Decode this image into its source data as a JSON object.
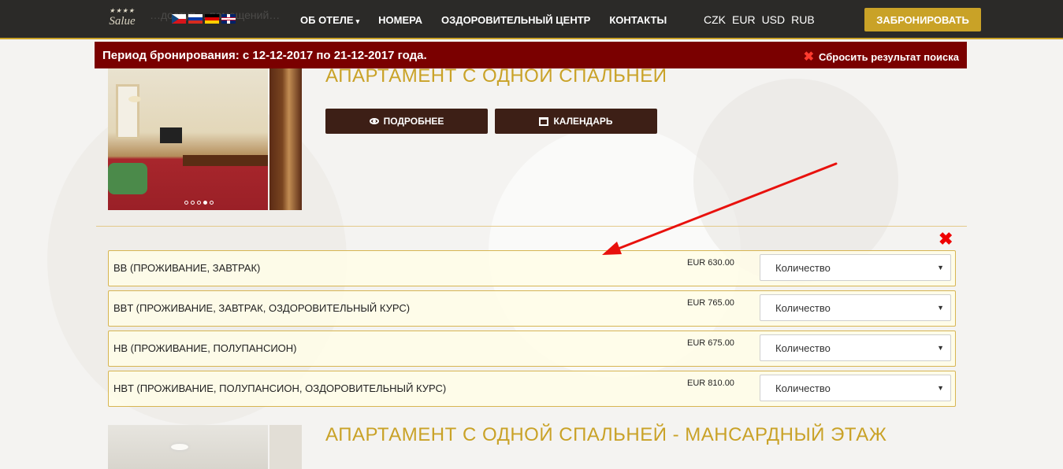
{
  "header": {
    "logo_text": "Salue",
    "logo_stars": "★★★★",
    "faded_text": "…доступ… помещений…",
    "flags": [
      "cz",
      "ru",
      "de",
      "gb"
    ],
    "nav": [
      {
        "label": "ОБ ОТЕЛЕ",
        "has_dropdown": true
      },
      {
        "label": "НОМЕРА",
        "has_dropdown": false
      },
      {
        "label": "ОЗДОРОВИТЕЛЬНЫЙ ЦЕНТР",
        "has_dropdown": false
      },
      {
        "label": "КОНТАКТЫ",
        "has_dropdown": false
      }
    ],
    "dropdown_caret": "▾",
    "currencies": [
      "CZK",
      "EUR",
      "USD",
      "RUB"
    ],
    "book_button": "ЗАБРОНИРОВАТЬ"
  },
  "period_bar": {
    "text": "Период бронирования: с 12-12-2017 по 21-12-2017 года.",
    "reset_icon": "✖",
    "reset_label": "Сбросить результат поиска"
  },
  "rooms": [
    {
      "title": "АПАРТАМЕНТ С ОДНОЙ СПАЛЬНЕЙ",
      "details_button": "ПОДРОБНЕЕ",
      "calendar_button": "КАЛЕНДАРЬ",
      "slider_count": 5,
      "slider_active": 4,
      "remove_icon": "✖",
      "rates": [
        {
          "name": "BB (ПРОЖИВАНИЕ, ЗАВТРАК)",
          "price": "EUR 630.00",
          "qty_placeholder": "Количество"
        },
        {
          "name": "BBT (ПРОЖИВАНИЕ, ЗАВТРАК, ОЗДОРОВИТЕЛЬНЫЙ КУРС)",
          "price": "EUR 765.00",
          "qty_placeholder": "Количество"
        },
        {
          "name": "HB (ПРОЖИВАНИЕ, ПОЛУПАНСИОН)",
          "price": "EUR 675.00",
          "qty_placeholder": "Количество"
        },
        {
          "name": "HBT (ПРОЖИВАНИЕ, ПОЛУПАНСИОН, ОЗДОРОВИТЕЛЬНЫЙ КУРС)",
          "price": "EUR 810.00",
          "qty_placeholder": "Количество"
        }
      ]
    },
    {
      "title": "АПАРТАМЕНТ С ОДНОЙ СПАЛЬНЕЙ - МАНСАРДНЫЙ ЭТАЖ"
    }
  ],
  "select_arrow": "▼",
  "colors": {
    "header_bg": "#2b2a28",
    "accent_gold": "#c9a227",
    "period_bar_bg": "#7a0000",
    "button_dark": "#3d1f16",
    "rate_row_bg": "#fffde7",
    "annotation_arrow": "#e8110d"
  }
}
